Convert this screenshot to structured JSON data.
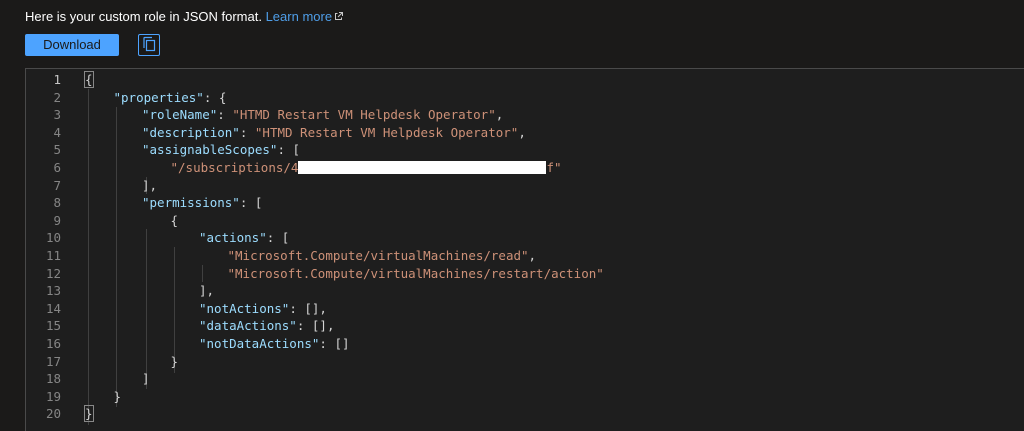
{
  "header": {
    "intro_text": "Here is your custom role in JSON format. ",
    "learn_more_label": "Learn more",
    "learn_more_icon": "external-link-icon"
  },
  "toolbar": {
    "download_label": "Download",
    "copy_icon": "copy-icon"
  },
  "colors": {
    "accent": "#4da3ff",
    "background": "#1b1a19",
    "editor_bg": "#1e1e1e",
    "json_key": "#9cdcfe",
    "json_string": "#ce9178",
    "line_number": "#858585"
  },
  "editor": {
    "active_line": 1,
    "lines": [
      {
        "num": "1",
        "tokens": [
          {
            "t": "punc",
            "v": "{"
          }
        ]
      },
      {
        "num": "2",
        "tokens": [
          {
            "t": "key",
            "v": "\"properties\""
          },
          {
            "t": "punc",
            "v": ": {"
          }
        ]
      },
      {
        "num": "3",
        "tokens": [
          {
            "t": "key",
            "v": "\"roleName\""
          },
          {
            "t": "punc",
            "v": ": "
          },
          {
            "t": "str",
            "v": "\"HTMD Restart VM Helpdesk Operator\""
          },
          {
            "t": "punc",
            "v": ","
          }
        ]
      },
      {
        "num": "4",
        "tokens": [
          {
            "t": "key",
            "v": "\"description\""
          },
          {
            "t": "punc",
            "v": ": "
          },
          {
            "t": "str",
            "v": "\"HTMD Restart VM Helpdesk Operator\""
          },
          {
            "t": "punc",
            "v": ","
          }
        ]
      },
      {
        "num": "5",
        "tokens": [
          {
            "t": "key",
            "v": "\"assignableScopes\""
          },
          {
            "t": "punc",
            "v": ": ["
          }
        ]
      },
      {
        "num": "6",
        "tokens": [
          {
            "t": "str",
            "v": "\"/subscriptions/4"
          },
          {
            "t": "redacted",
            "v": ""
          },
          {
            "t": "str",
            "v": "f\""
          }
        ]
      },
      {
        "num": "7",
        "tokens": [
          {
            "t": "punc",
            "v": "],"
          }
        ]
      },
      {
        "num": "8",
        "tokens": [
          {
            "t": "key",
            "v": "\"permissions\""
          },
          {
            "t": "punc",
            "v": ": ["
          }
        ]
      },
      {
        "num": "9",
        "tokens": [
          {
            "t": "punc",
            "v": "{"
          }
        ]
      },
      {
        "num": "10",
        "tokens": [
          {
            "t": "key",
            "v": "\"actions\""
          },
          {
            "t": "punc",
            "v": ": ["
          }
        ]
      },
      {
        "num": "11",
        "tokens": [
          {
            "t": "str",
            "v": "\"Microsoft.Compute/virtualMachines/read\""
          },
          {
            "t": "punc",
            "v": ","
          }
        ]
      },
      {
        "num": "12",
        "tokens": [
          {
            "t": "str",
            "v": "\"Microsoft.Compute/virtualMachines/restart/action\""
          }
        ]
      },
      {
        "num": "13",
        "tokens": [
          {
            "t": "punc",
            "v": "],"
          }
        ]
      },
      {
        "num": "14",
        "tokens": [
          {
            "t": "key",
            "v": "\"notActions\""
          },
          {
            "t": "punc",
            "v": ": [],"
          }
        ]
      },
      {
        "num": "15",
        "tokens": [
          {
            "t": "key",
            "v": "\"dataActions\""
          },
          {
            "t": "punc",
            "v": ": [],"
          }
        ]
      },
      {
        "num": "16",
        "tokens": [
          {
            "t": "key",
            "v": "\"notDataActions\""
          },
          {
            "t": "punc",
            "v": ": []"
          }
        ]
      },
      {
        "num": "17",
        "tokens": [
          {
            "t": "punc",
            "v": "}"
          }
        ]
      },
      {
        "num": "18",
        "tokens": [
          {
            "t": "punc",
            "v": "]"
          }
        ]
      },
      {
        "num": "19",
        "tokens": [
          {
            "t": "punc",
            "v": "}"
          }
        ]
      },
      {
        "num": "20",
        "tokens": [
          {
            "t": "punc",
            "v": "}"
          }
        ]
      }
    ]
  }
}
